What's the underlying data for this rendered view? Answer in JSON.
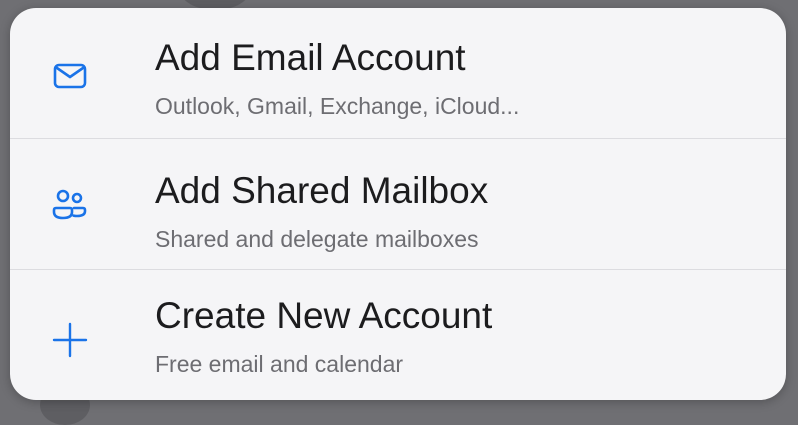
{
  "menu": {
    "items": [
      {
        "title": "Add Email Account",
        "subtitle": "Outlook, Gmail, Exchange, iCloud...",
        "icon": "envelope-icon"
      },
      {
        "title": "Add Shared Mailbox",
        "subtitle": "Shared and delegate mailboxes",
        "icon": "people-icon"
      },
      {
        "title": "Create New Account",
        "subtitle": "Free email and calendar",
        "icon": "plus-icon"
      }
    ]
  },
  "colors": {
    "accent": "#1a73e8",
    "sheet_background": "#f5f5f7",
    "title_text": "#1c1c1e",
    "subtitle_text": "#6d6d72",
    "divider": "#dcdce0",
    "backdrop": "#6f6f73"
  }
}
